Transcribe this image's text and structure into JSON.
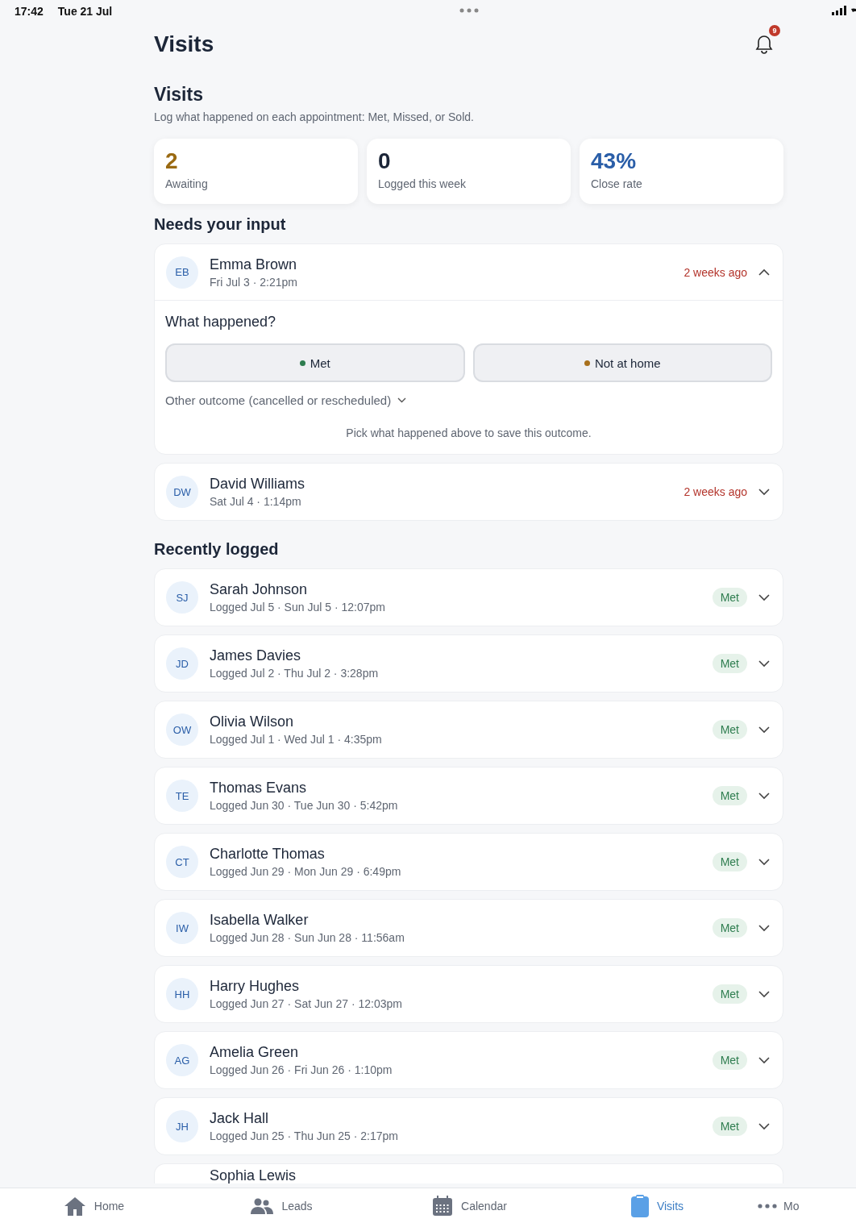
{
  "status_bar": {
    "time": "17:42",
    "date": "Tue 21 Jul"
  },
  "header": {
    "title": "Visits",
    "notification_count": "9"
  },
  "section": {
    "title": "Visits",
    "subtitle": "Log what happened on each appointment: Met, Missed, or Sold."
  },
  "stats": [
    {
      "value": "2",
      "label": "Awaiting",
      "color": "#9a6a12"
    },
    {
      "value": "0",
      "label": "Logged this week",
      "color": "#1c2638"
    },
    {
      "value": "43%",
      "label": "Close rate",
      "color": "#2a5ea8"
    }
  ],
  "needs_input": {
    "title": "Needs your input",
    "items": [
      {
        "initials": "EB",
        "name": "Emma Brown",
        "when": "Fri Jul 3 · 2:21pm",
        "age": "2 weeks ago",
        "expanded": true,
        "question": "What happened?",
        "outcomes": [
          {
            "label": "Met",
            "color": "#2e7d4f"
          },
          {
            "label": "Not at home",
            "color": "#a8701c"
          }
        ],
        "other": "Other outcome (cancelled or rescheduled)",
        "hint": "Pick what happened above to save this outcome."
      },
      {
        "initials": "DW",
        "name": "David Williams",
        "when": "Sat Jul 4 · 1:14pm",
        "age": "2 weeks ago",
        "expanded": false
      }
    ]
  },
  "recent": {
    "title": "Recently logged",
    "items": [
      {
        "initials": "SJ",
        "name": "Sarah Johnson",
        "when": "Logged Jul 5 · Sun Jul 5 · 12:07pm",
        "status": "Met"
      },
      {
        "initials": "JD",
        "name": "James Davies",
        "when": "Logged Jul 2 · Thu Jul 2 · 3:28pm",
        "status": "Met"
      },
      {
        "initials": "OW",
        "name": "Olivia Wilson",
        "when": "Logged Jul 1 · Wed Jul 1 · 4:35pm",
        "status": "Met"
      },
      {
        "initials": "TE",
        "name": "Thomas Evans",
        "when": "Logged Jun 30 · Tue Jun 30 · 5:42pm",
        "status": "Met"
      },
      {
        "initials": "CT",
        "name": "Charlotte Thomas",
        "when": "Logged Jun 29 · Mon Jun 29 · 6:49pm",
        "status": "Met"
      },
      {
        "initials": "IW",
        "name": "Isabella Walker",
        "when": "Logged Jun 28 · Sun Jun 28 · 11:56am",
        "status": "Met"
      },
      {
        "initials": "HH",
        "name": "Harry Hughes",
        "when": "Logged Jun 27 · Sat Jun 27 · 12:03pm",
        "status": "Met"
      },
      {
        "initials": "AG",
        "name": "Amelia Green",
        "when": "Logged Jun 26 · Fri Jun 26 · 1:10pm",
        "status": "Met"
      },
      {
        "initials": "JH",
        "name": "Jack Hall",
        "when": "Logged Jun 25 · Thu Jun 25 · 2:17pm",
        "status": "Met"
      }
    ],
    "cut_off_item": {
      "name": "Sophia Lewis"
    }
  },
  "tab_bar": [
    {
      "kind": "home",
      "label": "Home",
      "selected": false
    },
    {
      "kind": "leads",
      "label": "Leads",
      "selected": false
    },
    {
      "kind": "calendar",
      "label": "Calendar",
      "selected": false
    },
    {
      "kind": "visits",
      "label": "Visits",
      "selected": true
    },
    {
      "kind": "more",
      "label": "Mo",
      "selected": false
    }
  ]
}
